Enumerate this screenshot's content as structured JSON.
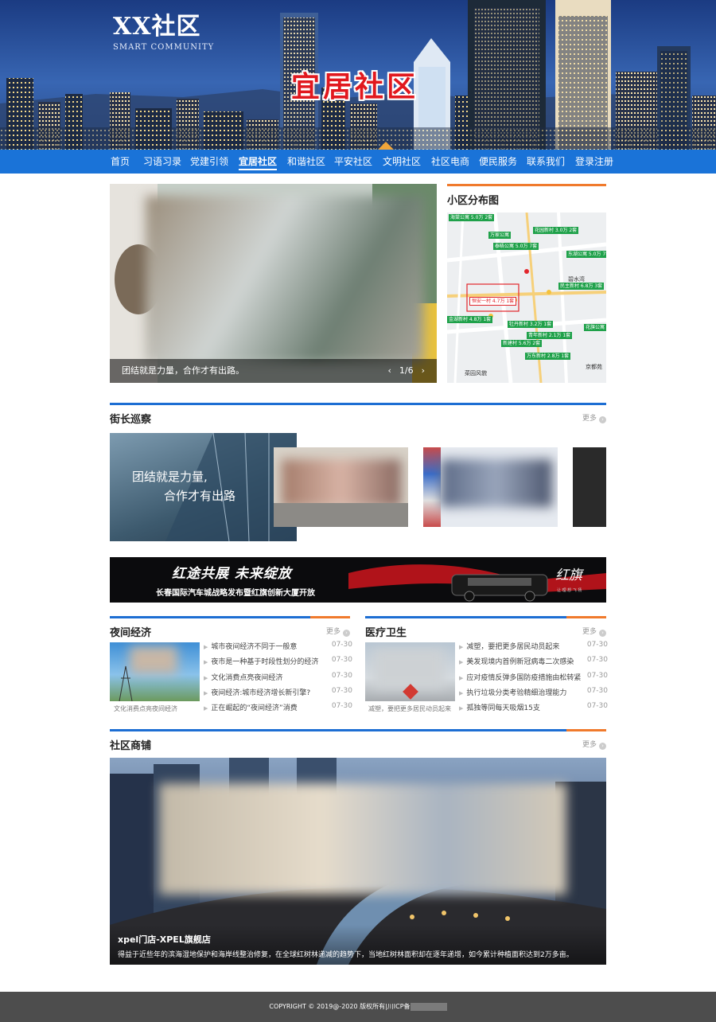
{
  "site": {
    "logo_title": "XX社区",
    "logo_subtitle": "SMART COMMUNITY",
    "slogan": "宜居社区"
  },
  "nav": {
    "items": [
      "首页",
      "习语习录",
      "党建引领",
      "宜居社区",
      "和谐社区",
      "平安社区",
      "文明社区",
      "社区电商",
      "便民服务",
      "联系我们",
      "登录注册"
    ],
    "active_index": 3
  },
  "hero": {
    "caption": "团结就是力量，合作才有出路。",
    "pager": "1/6",
    "prev_icon": "chevron-left-icon",
    "next_icon": "chevron-right-icon"
  },
  "map_section": {
    "title": "小区分布图",
    "tags": [
      "海棠公寓 5.0万 2套",
      "万家公寓",
      "泰晤公寓 5.0万 7套",
      "花园新村 3.0万 2套",
      "东湖公寓 5.0万 7套",
      "民主新村 6.8万 3套",
      "恒安一村 4.7万 1套",
      "牡丹新村 3.2万 1套",
      "青年新村 2.1万 1套",
      "万东新村 2.8万 1套",
      "新建村 5.6万 2套",
      "金湖新村 4.8万 1套",
      "花旗公寓"
    ],
    "labels": [
      "菜园风貌",
      "京都苑",
      "碧水湾"
    ]
  },
  "patrol": {
    "title": "街长巡察",
    "more": "更多",
    "poster_line1": "团结就是力量,",
    "poster_line2": "合作才有出路"
  },
  "ad": {
    "headline": "红途共展 未来绽放",
    "subline": "长春国际汽车城战略发布暨红旗创新大厦开放",
    "brand": "红旗",
    "brand_sub": "让 理 想 飞 扬"
  },
  "night_economy": {
    "title": "夜间经济",
    "more": "更多",
    "image_caption": "文化消费点亮夜间经济",
    "items": [
      {
        "text": "城市夜间经济不同于一般意",
        "date": "07-30"
      },
      {
        "text": "夜市是一种基于时段性划分的经济",
        "date": "07-30"
      },
      {
        "text": "文化消费点亮夜间经济",
        "date": "07-30"
      },
      {
        "text": "夜间经济:城市经济增长新引擎?",
        "date": "07-30"
      },
      {
        "text": "正在崛起的“夜间经济”消费",
        "date": "07-30"
      }
    ]
  },
  "healthcare": {
    "title": "医疗卫生",
    "more": "更多",
    "image_caption": "减塑，要把更多居民动员起来",
    "items": [
      {
        "text": "减塑，要把更多居民动员起来",
        "date": "07-30"
      },
      {
        "text": "美发现境内首例新冠病毒二次感染",
        "date": "07-30"
      },
      {
        "text": "应对疫情反弹多国防疫措施由松转紧",
        "date": "07-30"
      },
      {
        "text": "执行垃圾分类考验精细治理能力",
        "date": "07-30"
      },
      {
        "text": "孤独等同每天吸烟15支",
        "date": "07-30"
      }
    ]
  },
  "shop": {
    "title": "社区商铺",
    "more": "更多",
    "feature_title": "xpel门店-XPEL旗舰店",
    "feature_desc": "得益于近些年的滨海湿地保护和海岸线整治修复，在全球红树林递减的趋势下，当地红树林面积却在逐年递增，如今累计种植面积达到2万多亩。"
  },
  "footer": {
    "text": "COPYRIGHT © 2019@-2020  版权所有|川ICP备"
  },
  "colors": {
    "nav_blue": "#1a73d8",
    "accent_orange": "#f07a2c",
    "accent_blue": "#1d6ed3",
    "tag_green": "#1fa14a",
    "slogan_red": "#e1181e",
    "footer_gray": "#4d4d4d"
  }
}
